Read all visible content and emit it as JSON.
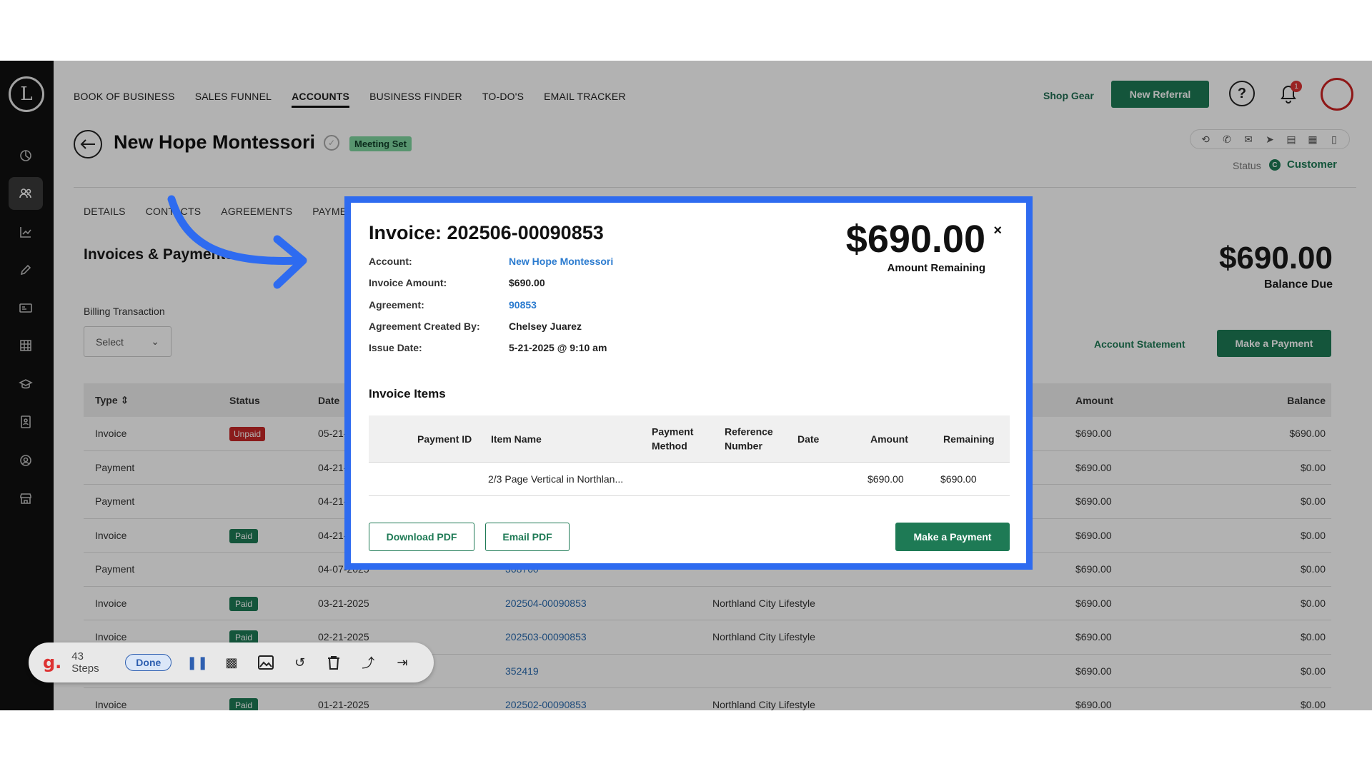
{
  "nav": {
    "items": [
      "BOOK OF BUSINESS",
      "SALES FUNNEL",
      "ACCOUNTS",
      "BUSINESS FINDER",
      "TO-DO'S",
      "EMAIL TRACKER"
    ],
    "active": "ACCOUNTS",
    "shop_gear": "Shop Gear",
    "new_referral": "New Referral",
    "help_glyph": "?",
    "notification_count": "1"
  },
  "sidebar": {
    "logo_glyph": "L",
    "icons": [
      "chart-pie-icon",
      "users-icon",
      "trend-chart-icon",
      "pencil-icon",
      "id-card-icon",
      "grid-icon",
      "graduation-cap-icon",
      "contact-book-icon",
      "user-circle-icon",
      "store-icon"
    ],
    "active_index": 1
  },
  "account": {
    "name": "New Hope Montessori",
    "stage_badge": "Meeting Set",
    "status_label": "Status",
    "status_value": "Customer",
    "status_glyph": "C"
  },
  "subtabs": [
    "DETAILS",
    "CONTACTS",
    "AGREEMENTS",
    "PAYMENTS"
  ],
  "billing": {
    "section_title": "Invoices & Payments",
    "balance_due": "$690.00",
    "balance_due_label": "Balance Due",
    "filter_label": "Billing Transaction",
    "filter_value": "Select",
    "account_statement": "Account Statement",
    "make_payment": "Make a Payment",
    "columns": [
      "Type",
      "Status",
      "Date",
      "Amount",
      "Balance"
    ],
    "rows": [
      {
        "type": "Invoice",
        "status": "Unpaid",
        "date": "05-21-2025",
        "number": "",
        "desc": "",
        "amount": "$690.00",
        "balance": "$690.00"
      },
      {
        "type": "Payment",
        "status": "",
        "date": "04-21-2025",
        "number": "",
        "desc": "",
        "amount": "$690.00",
        "balance": "$0.00"
      },
      {
        "type": "Payment",
        "status": "",
        "date": "04-21-2025",
        "number": "",
        "desc": "",
        "amount": "$690.00",
        "balance": "$0.00"
      },
      {
        "type": "Invoice",
        "status": "Paid",
        "date": "04-21-2025",
        "number": "",
        "desc": "",
        "amount": "$690.00",
        "balance": "$0.00"
      },
      {
        "type": "Payment",
        "status": "",
        "date": "04-07-2025",
        "number": "368760",
        "desc": "",
        "amount": "$690.00",
        "balance": "$0.00"
      },
      {
        "type": "Invoice",
        "status": "Paid",
        "date": "03-21-2025",
        "number": "202504-00090853",
        "desc": "Northland City Lifestyle",
        "amount": "$690.00",
        "balance": "$0.00"
      },
      {
        "type": "Invoice",
        "status": "Paid",
        "date": "02-21-2025",
        "number": "202503-00090853",
        "desc": "Northland City Lifestyle",
        "amount": "$690.00",
        "balance": "$0.00"
      },
      {
        "type": "Payment",
        "status": "",
        "date": "",
        "number": "352419",
        "desc": "",
        "amount": "$690.00",
        "balance": "$0.00"
      },
      {
        "type": "Invoice",
        "status": "Paid",
        "date": "01-21-2025",
        "number": "202502-00090853",
        "desc": "Northland City Lifestyle",
        "amount": "$690.00",
        "balance": "$0.00"
      }
    ]
  },
  "modal": {
    "title": "Invoice: 202506-00090853",
    "amount_remaining": "$690.00",
    "amount_remaining_label": "Amount Remaining",
    "close_glyph": "×",
    "fields": [
      {
        "label": "Account:",
        "value": "New Hope Montessori",
        "link": true
      },
      {
        "label": "Invoice Amount:",
        "value": "$690.00",
        "link": false
      },
      {
        "label": "Agreement:",
        "value": "90853",
        "link": true
      },
      {
        "label": "Agreement Created By:",
        "value": "Chelsey Juarez",
        "link": false
      },
      {
        "label": "Issue Date:",
        "value": "5-21-2025 @ 9:10 am",
        "link": false
      }
    ],
    "items_title": "Invoice Items",
    "item_columns": [
      "Payment ID",
      "Item Name",
      "Payment Method",
      "Reference Number",
      "Date",
      "Amount",
      "Remaining"
    ],
    "items": [
      {
        "payment_id": "",
        "item_name": "2/3 Page Vertical in Northlan...",
        "payment_method": "",
        "reference_number": "",
        "date": "",
        "amount": "$690.00",
        "remaining": "$690.00"
      }
    ],
    "download_pdf": "Download PDF",
    "email_pdf": "Email PDF",
    "make_payment": "Make a Payment"
  },
  "recorder": {
    "logo": "g.",
    "steps": "43 Steps",
    "done": "Done",
    "icons": [
      "pause-icon",
      "blur-icon",
      "image-icon",
      "undo-icon",
      "trash-icon",
      "upload-icon",
      "skip-end-icon"
    ]
  },
  "colors": {
    "brand_green": "#1e7a55",
    "highlight_blue": "#2e6bf0",
    "link_blue": "#2b7bcf",
    "unpaid_red": "#c62828"
  }
}
